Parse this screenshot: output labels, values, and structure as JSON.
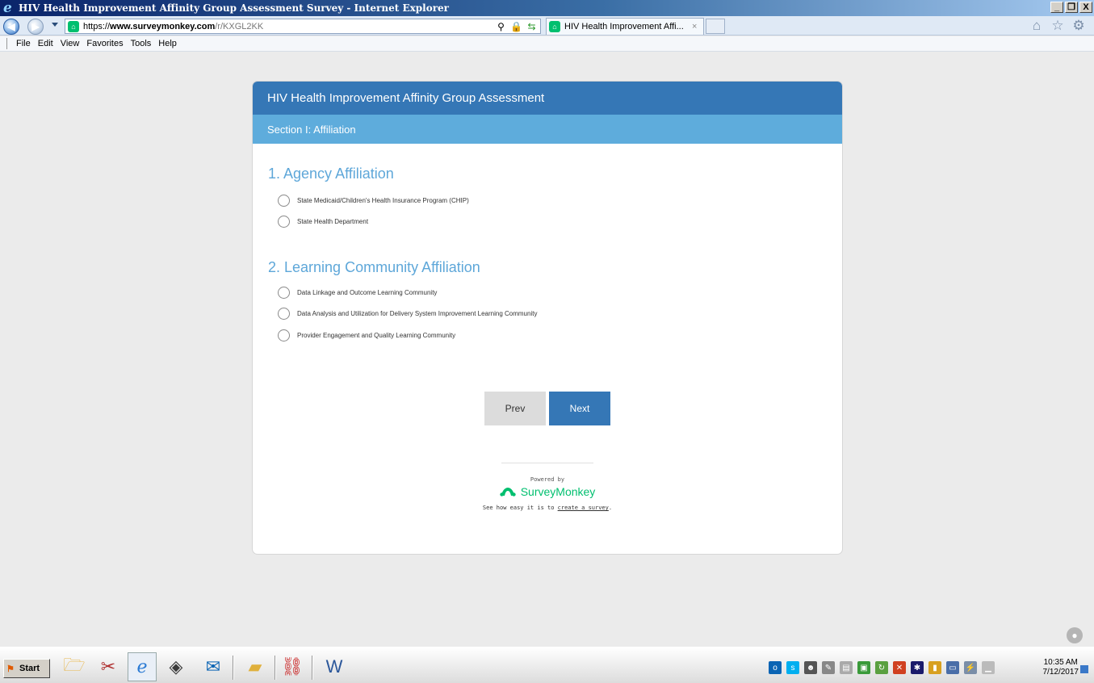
{
  "window": {
    "title": "HIV Health Improvement Affinity Group Assessment Survey - Internet Explorer",
    "minimize_glyph": "_",
    "restore_glyph": "❐",
    "close_glyph": "X"
  },
  "browser": {
    "url_scheme": "https://",
    "url_host": "www.surveymonkey.com",
    "url_path": "/r/KXGL2KK",
    "tab_title": "HIV Health Improvement Affi...",
    "tab_close": "×",
    "icons": [
      "back-icon",
      "forward-icon",
      "search-icon",
      "lock-icon",
      "compatibility-icon",
      "home-icon",
      "favorites-star-icon",
      "settings-gear-icon"
    ]
  },
  "menu": {
    "items": [
      "File",
      "Edit",
      "View",
      "Favorites",
      "Tools",
      "Help"
    ]
  },
  "survey": {
    "title": "HIV Health Improvement Affinity Group Assessment",
    "section": "Section I: Affiliation",
    "questions": [
      {
        "label": "1. Agency Affiliation",
        "options": [
          "State Medicaid/Children's Health Insurance Program (CHIP)",
          "State Health Department"
        ]
      },
      {
        "label": "2. Learning Community Affiliation",
        "options": [
          "Data Linkage and Outcome Learning Community",
          "Data Analysis and Utilization for Delivery System Improvement Learning Community",
          "Provider Engagement and Quality Learning Community"
        ]
      }
    ],
    "prev_label": "Prev",
    "next_label": "Next",
    "powered_by": "Powered by",
    "brand": "SurveyMonkey",
    "tagline_prefix": "See how easy it is to ",
    "tagline_link": "create a survey",
    "tagline_suffix": "."
  },
  "taskbar": {
    "start_label": "Start",
    "apps": [
      "file-explorer-icon",
      "snipping-tool-icon",
      "internet-explorer-icon",
      "tablet-icon",
      "outlook-icon",
      "windows-explorer-icon",
      "acrobat-icon",
      "word-icon"
    ],
    "time": "10:35 AM",
    "date": "7/12/2017"
  },
  "colors": {
    "header": "#3577b6",
    "section": "#5eacdc",
    "question": "#5ea7d9",
    "brand_green": "#00bf6f"
  }
}
